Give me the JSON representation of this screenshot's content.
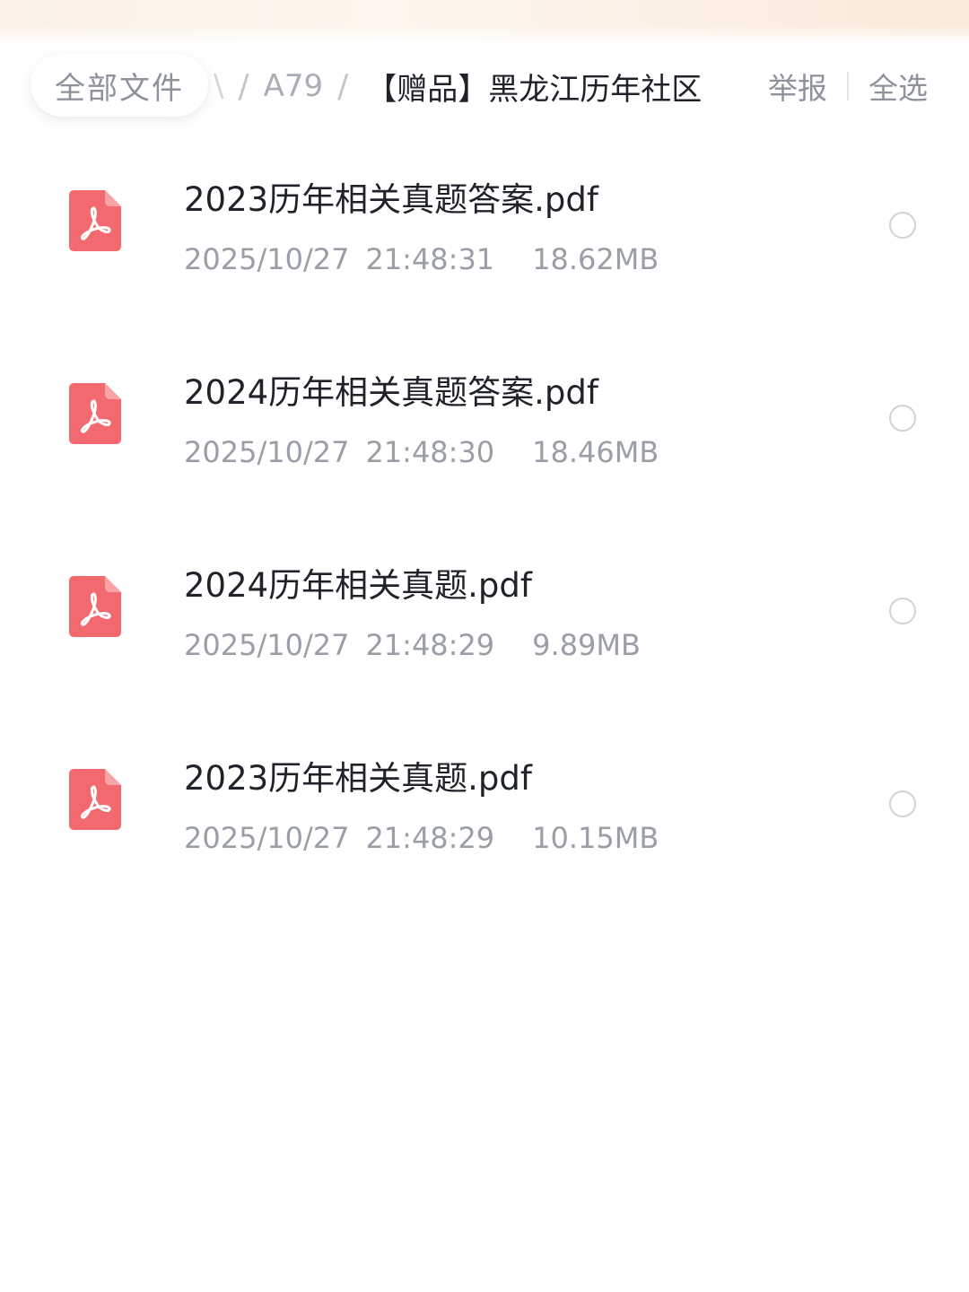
{
  "breadcrumb": {
    "home_label": "全部文件",
    "hidden_fragment": "\\",
    "separator": "/",
    "parent_label": "A79",
    "current_label": "【赠品】黑龙江历年社区"
  },
  "actions": {
    "report_label": "举报",
    "select_all_label": "全选"
  },
  "colors": {
    "pdf_icon": "#f26a6f",
    "primary_text": "#1f2329",
    "secondary_text": "#9a9ea6"
  },
  "files": [
    {
      "name": "2023历年相关真题答案.pdf",
      "date": "2025/10/27",
      "time": "21:48:31",
      "size": "18.62MB",
      "icon": "pdf-icon"
    },
    {
      "name": "2024历年相关真题答案.pdf",
      "date": "2025/10/27",
      "time": "21:48:30",
      "size": "18.46MB",
      "icon": "pdf-icon"
    },
    {
      "name": "2024历年相关真题.pdf",
      "date": "2025/10/27",
      "time": "21:48:29",
      "size": "9.89MB",
      "icon": "pdf-icon"
    },
    {
      "name": "2023历年相关真题.pdf",
      "date": "2025/10/27",
      "time": "21:48:29",
      "size": "10.15MB",
      "icon": "pdf-icon"
    }
  ]
}
